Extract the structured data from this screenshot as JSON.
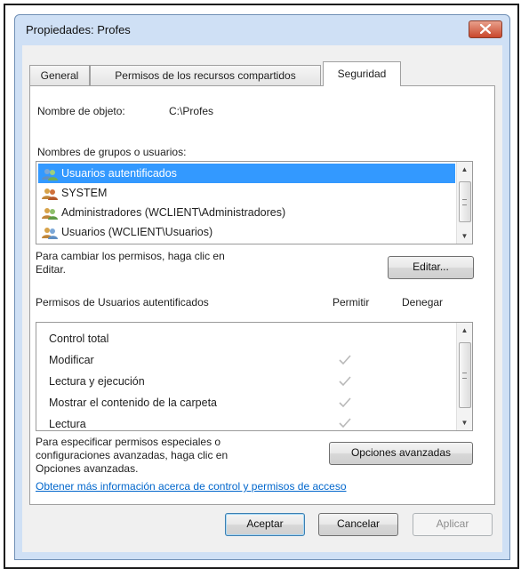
{
  "window": {
    "title": "Propiedades: Profes"
  },
  "tabs": [
    {
      "label": "General",
      "active": false
    },
    {
      "label": "Permisos de los recursos compartidos",
      "active": false
    },
    {
      "label": "Seguridad",
      "active": true
    }
  ],
  "object": {
    "label": "Nombre de objeto:",
    "value": "C:\\Profes"
  },
  "groups": {
    "label": "Nombres de grupos o usuarios:",
    "items": [
      {
        "label": "Usuarios autentificados",
        "selected": true
      },
      {
        "label": "SYSTEM",
        "selected": false
      },
      {
        "label": "Administradores (WCLIENT\\Administradores)",
        "selected": false
      },
      {
        "label": "Usuarios (WCLIENT\\Usuarios)",
        "selected": false
      }
    ]
  },
  "edit": {
    "hint": "Para cambiar los permisos, haga clic en Editar.",
    "button": "Editar..."
  },
  "permissions": {
    "label": "Permisos de Usuarios autentificados",
    "allow_header": "Permitir",
    "deny_header": "Denegar",
    "items": [
      {
        "label": "Control total",
        "allow": false,
        "deny": false
      },
      {
        "label": "Modificar",
        "allow": true,
        "deny": false
      },
      {
        "label": "Lectura y ejecución",
        "allow": true,
        "deny": false
      },
      {
        "label": "Mostrar el contenido de la carpeta",
        "allow": true,
        "deny": false
      },
      {
        "label": "Lectura",
        "allow": true,
        "deny": false
      }
    ]
  },
  "advanced": {
    "hint": "Para especificar permisos especiales o configuraciones avanzadas, haga clic en Opciones avanzadas.",
    "button": "Opciones avanzadas"
  },
  "link": "Obtener más información acerca de control y permisos de acceso",
  "footer": {
    "ok": "Aceptar",
    "cancel": "Cancelar",
    "apply": "Aplicar"
  },
  "colors": {
    "selection": "#3399ff",
    "link": "#0066cc",
    "check_disabled": "#b9b9b9",
    "title_bar": "#cfe0f5"
  }
}
